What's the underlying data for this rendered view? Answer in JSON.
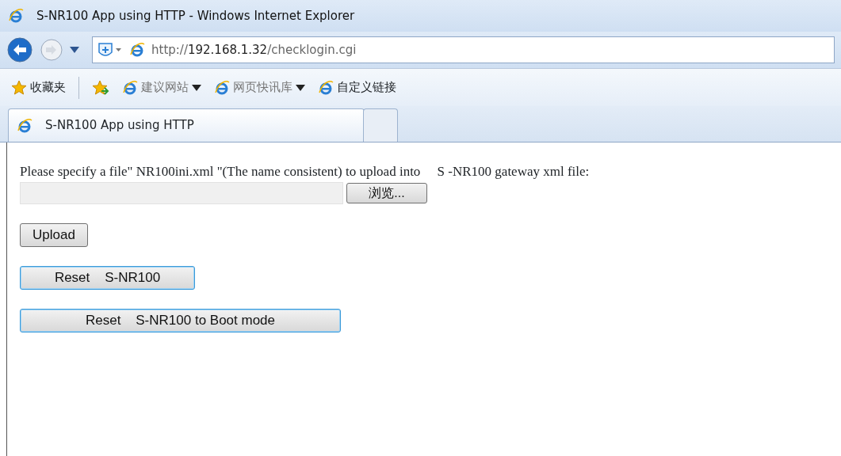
{
  "window": {
    "title": "S-NR100 App using HTTP - Windows Internet Explorer"
  },
  "navigation": {
    "back_enabled": true,
    "forward_enabled": false
  },
  "address_bar": {
    "url": "http://**192.168.1.32**/checklogin.cgi"
  },
  "favorites_bar": {
    "favorites_label": "收藏夹",
    "links": [
      {
        "label": "建议网站",
        "has_menu": true,
        "dimmed": true
      },
      {
        "label": "网页快讯库",
        "has_menu": true,
        "dimmed": true
      },
      {
        "label": "自定义链接",
        "has_menu": false,
        "dimmed": false
      }
    ]
  },
  "tabs": [
    {
      "label": "S-NR100 App using HTTP",
      "selected": true
    },
    {
      "selected": false
    }
  ],
  "page": {
    "instruction": "Please specify a file\" NR100ini.xml \"(The name consistent) to upload into     S -NR100 gateway xml file:",
    "file_input": {
      "browse_label": "浏览..."
    },
    "buttons": [
      {
        "label": "Upload",
        "focused": false
      },
      {
        "label": "Reset    S-NR100",
        "focused": true
      },
      {
        "label": "Reset    S-NR100 to Boot mode",
        "focused": true
      }
    ]
  }
}
